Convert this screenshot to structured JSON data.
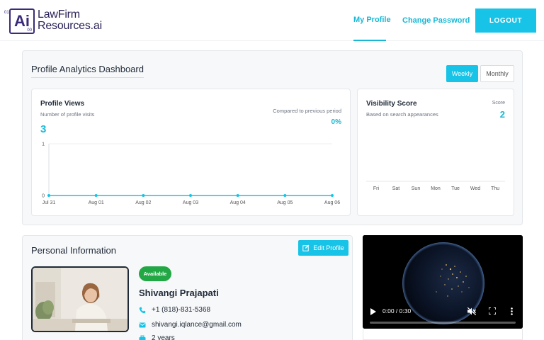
{
  "header": {
    "logo": {
      "letters": "Ai",
      "num_top": "01",
      "num_bottom": "00"
    },
    "brand_line1": "LawFirm",
    "brand_line2": "Resources.ai",
    "nav": [
      {
        "label": "My Profile",
        "active": true
      },
      {
        "label": "Change Password",
        "active": false
      }
    ],
    "logout_label": "LOGOUT"
  },
  "analytics": {
    "title": "Profile Analytics Dashboard",
    "toggle": {
      "weekly": "Weekly",
      "monthly": "Monthly",
      "selected": "Weekly"
    },
    "views_card": {
      "title": "Profile Views",
      "subtitle": "Number of profile visits",
      "value": "3",
      "compare_label": "Compared to previous period",
      "compare_value": "0%"
    },
    "visibility_card": {
      "title": "Visibility Score",
      "subtitle": "Based on search appearances",
      "score_label": "Score",
      "score_value": "2"
    }
  },
  "chart_data": [
    {
      "type": "line",
      "x": [
        "Jul 31",
        "Aug 01",
        "Aug 02",
        "Aug 03",
        "Aug 04",
        "Aug 05",
        "Aug 06"
      ],
      "series": [
        {
          "values": [
            0,
            0,
            0,
            0,
            0,
            0,
            0
          ]
        }
      ],
      "ylim": [
        0,
        1
      ],
      "yticks": [
        "0",
        "1"
      ],
      "grid": true,
      "color": "#17c3e6"
    },
    {
      "type": "line",
      "x": [
        "Fri",
        "Sat",
        "Sun",
        "Mon",
        "Tue",
        "Wed",
        "Thu"
      ],
      "series": []
    }
  ],
  "personal": {
    "title": "Personal Information",
    "edit_label": "Edit Profile",
    "status_badge": "Available",
    "name": "Shivangi Prajapati",
    "phone": "+1 (818)-831-5368",
    "email": "shivangi.iqlance@gmail.com",
    "experience": "2 years"
  },
  "video": {
    "time": "0:00 / 0:30",
    "progress": 0
  },
  "colors": {
    "accent": "#17c3e6",
    "brand": "#3b2a7a",
    "available": "#22a745"
  }
}
